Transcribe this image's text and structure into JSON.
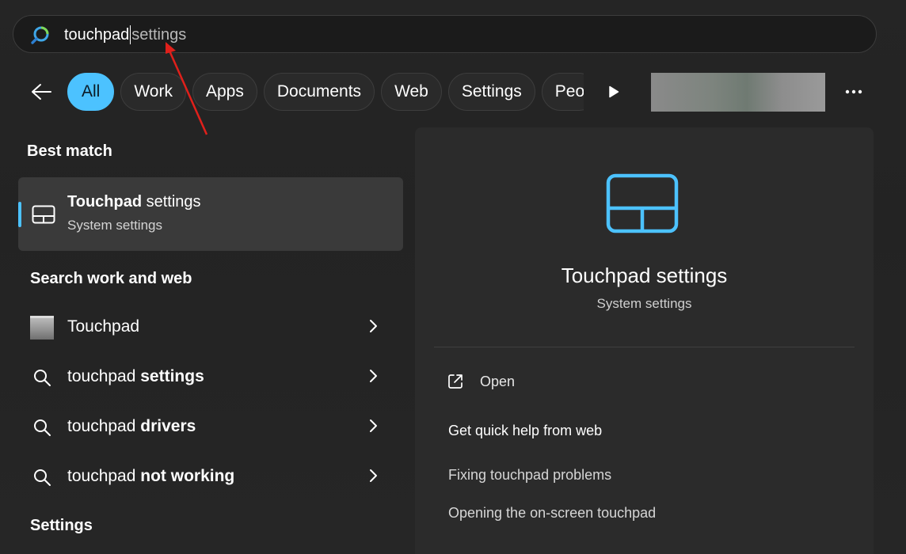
{
  "search": {
    "typed_text": "touchpad",
    "suggestion_text": "settings",
    "icon": "search-logo-icon"
  },
  "filters": {
    "back_icon": "back-arrow-icon",
    "chips": [
      {
        "label": "All",
        "active": true
      },
      {
        "label": "Work",
        "active": false
      },
      {
        "label": "Apps",
        "active": false
      },
      {
        "label": "Documents",
        "active": false
      },
      {
        "label": "Web",
        "active": false
      },
      {
        "label": "Settings",
        "active": false
      },
      {
        "label": "Peo",
        "active": false
      }
    ],
    "play_icon": "play-icon",
    "more_icon": "more-icon"
  },
  "best_match": {
    "heading": "Best match",
    "title_bold": "Touchpad",
    "title_rest": " settings",
    "subtitle": "System settings",
    "icon": "touchpad-icon"
  },
  "search_web": {
    "heading": "Search work and web",
    "items": [
      {
        "bold_first": false,
        "normal": "Touchpad",
        "bold": "",
        "icon": "thumbnail-icon"
      },
      {
        "bold_first": false,
        "normal": "touchpad ",
        "bold": "settings",
        "icon": "search-icon"
      },
      {
        "bold_first": false,
        "normal": "touchpad ",
        "bold": "drivers",
        "icon": "search-icon"
      },
      {
        "bold_first": false,
        "normal": "touchpad ",
        "bold": "not working",
        "icon": "search-icon"
      }
    ]
  },
  "settings_heading": "Settings",
  "details": {
    "title": "Touchpad settings",
    "subtitle": "System settings",
    "open_label": "Open",
    "help_title": "Get quick help from web",
    "links": [
      "Fixing touchpad problems",
      "Opening the on-screen touchpad"
    ]
  },
  "colors": {
    "accent": "#4cc2ff",
    "background": "#202020",
    "panel": "#2b2b2b",
    "annotation_arrow": "#e0201b"
  }
}
